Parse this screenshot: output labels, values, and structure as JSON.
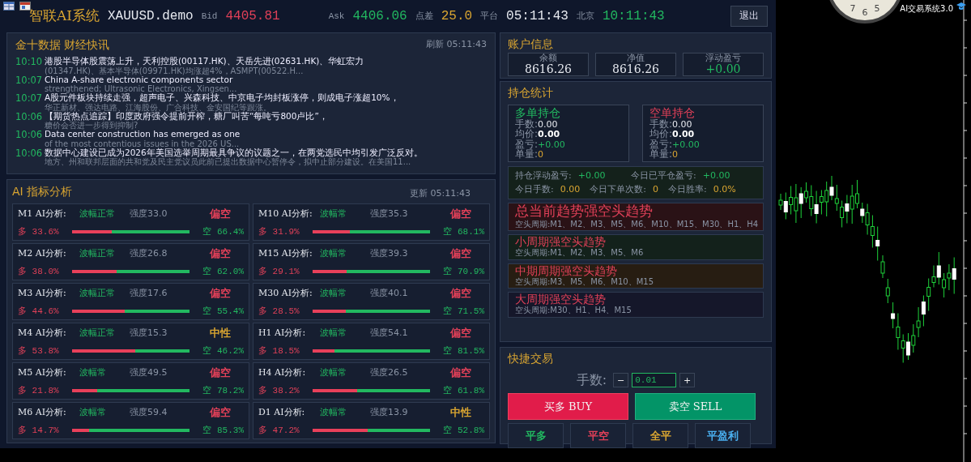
{
  "header": {
    "title": "智联AI系统",
    "symbol": "XAUUSD.demo",
    "bid_label": "Bid",
    "bid": "4405.81",
    "ask_label": "Ask",
    "ask": "4406.06",
    "spread_label": "点差",
    "spread": "25.0",
    "platform_label": "平台",
    "platform_time": "05:11:43",
    "beijing_label": "北京",
    "beijing_time": "10:11:43",
    "exit_button": "退出"
  },
  "news": {
    "title": "金十数据 财经快讯",
    "refresh": "刷新 05:11:43",
    "items": [
      {
        "time": "10:10",
        "headline": "港股半导体股震荡上升，天利控股(00117.HK)、天岳先进(02631.HK)、华虹宏力",
        "detail": "(01347.HK)、基本半导体(09971.HK)均涨超4%，ASMPT(00522.H..."
      },
      {
        "time": "10:07",
        "headline": "China A-share electronic components sector",
        "detail": "strengthened; Ultrasonic Electronics, Xingsen..."
      },
      {
        "time": "10:07",
        "headline": "A股元件板块持续走强，超声电子、兴森科技、中京电子均封板涨停，则成电子涨超10%，",
        "detail": "华正新材、强达电路、江海股份、广合科技、金安国纪等跟涨。"
      },
      {
        "time": "10:06",
        "headline": "【期货热点追踪】印度政府强令提前开榨，糖厂叫苦“每吨亏800卢比”，",
        "detail": "糖价会否进一步得到抑制?"
      },
      {
        "time": "10:06",
        "headline": "Data center construction has emerged as one",
        "detail": "of the most contentious issues in the 2026 US..."
      },
      {
        "time": "10:06",
        "headline": "数据中心建设已成为2026年美国选举周期最具争议的议题之一，在两党选民中均引发广泛反对。",
        "detail": "地方、州和联邦层面的共和党及民主党议员此前已提出数据中心暂停令，拟中止部分建设。在美国11..."
      }
    ]
  },
  "ai": {
    "title": "AI 指标分析",
    "updated": "更新 05:11:43",
    "cards": [
      {
        "label": "M1 AI分析:",
        "volatility": "波幅正常",
        "strength": "强度33.0",
        "bias": "偏空",
        "color": "#e04058",
        "bull": "多 33.6%",
        "bear": "空 66.4%",
        "level": 0.336
      },
      {
        "label": "M10 AI分析:",
        "volatility": "波幅常",
        "strength": "强度35.3",
        "bias": "偏空",
        "color": "#e04058",
        "bull": "多 31.9%",
        "bear": "空 68.1%",
        "level": 0.319
      },
      {
        "label": "M2 AI分析:",
        "volatility": "波幅正常",
        "strength": "强度26.8",
        "bias": "偏空",
        "color": "#e04058",
        "bull": "多 38.0%",
        "bear": "空 62.0%",
        "level": 0.38
      },
      {
        "label": "M15 AI分析:",
        "volatility": "波幅常",
        "strength": "强度39.3",
        "bias": "偏空",
        "color": "#e04058",
        "bull": "多 29.1%",
        "bear": "空 70.9%",
        "level": 0.291
      },
      {
        "label": "M3 AI分析:",
        "volatility": "波幅正常",
        "strength": "强度17.6",
        "bias": "偏空",
        "color": "#e04058",
        "bull": "多 44.6%",
        "bear": "空 55.4%",
        "level": 0.446
      },
      {
        "label": "M30 AI分析:",
        "volatility": "波幅常",
        "strength": "强度40.1",
        "bias": "偏空",
        "color": "#e04058",
        "bull": "多 28.5%",
        "bear": "空 71.5%",
        "level": 0.285
      },
      {
        "label": "M4 AI分析:",
        "volatility": "波幅正常",
        "strength": "强度15.3",
        "bias": "中性",
        "color": "#d9a531",
        "bull": "多 53.8%",
        "bear": "空 46.2%",
        "level": 0.538
      },
      {
        "label": "H1 AI分析:",
        "volatility": "波幅常",
        "strength": "强度54.1",
        "bias": "偏空",
        "color": "#e04058",
        "bull": "多 18.5%",
        "bear": "空 81.5%",
        "level": 0.185
      },
      {
        "label": "M5 AI分析:",
        "volatility": "波幅常",
        "strength": "强度49.5",
        "bias": "偏空",
        "color": "#e04058",
        "bull": "多 21.8%",
        "bear": "空 78.2%",
        "level": 0.218
      },
      {
        "label": "H4 AI分析:",
        "volatility": "波幅常",
        "strength": "强度26.5",
        "bias": "偏空",
        "color": "#e04058",
        "bull": "多 38.2%",
        "bear": "空 61.8%",
        "level": 0.382
      },
      {
        "label": "M6 AI分析:",
        "volatility": "波幅常",
        "strength": "强度59.4",
        "bias": "偏空",
        "color": "#e04058",
        "bull": "多 14.7%",
        "bear": "空 85.3%",
        "level": 0.147
      },
      {
        "label": "D1 AI分析:",
        "volatility": "波幅常",
        "strength": "强度13.9",
        "bias": "中性",
        "color": "#d9a531",
        "bull": "多 47.2%",
        "bear": "空 52.8%",
        "level": 0.472
      }
    ]
  },
  "account": {
    "title": "账户信息",
    "items": [
      {
        "label": "余额",
        "value": "8616.26",
        "color": "#e6e9ef"
      },
      {
        "label": "净值",
        "value": "8616.26",
        "color": "#e6e9ef"
      },
      {
        "label": "浮动盈亏",
        "value": "+0.00",
        "color": "#22b860"
      }
    ]
  },
  "positions": {
    "title": "持仓统计",
    "sides": [
      {
        "title": "多单持仓",
        "color": "#22b860",
        "fields": [
          {
            "label": "手数:",
            "value": "0.00",
            "color": "#e6e9ef"
          },
          {
            "label": "均价:",
            "value": "0.00",
            "color": "#ffffff"
          },
          {
            "label": "盈亏:",
            "value": "+0.00",
            "color": "#22b860"
          },
          {
            "label": "单量:",
            "value": "0",
            "color": "#d9a531"
          }
        ]
      },
      {
        "title": "空单持仓",
        "color": "#e04058",
        "fields": [
          {
            "label": "手数:",
            "value": "0.00",
            "color": "#e6e9ef"
          },
          {
            "label": "均价:",
            "value": "0.00",
            "color": "#ffffff"
          },
          {
            "label": "盈亏:",
            "value": "+0.00",
            "color": "#22b860"
          },
          {
            "label": "单量:",
            "value": "0",
            "color": "#d9a531"
          }
        ]
      }
    ],
    "stats": [
      {
        "label": "持仓浮动盈亏:",
        "value": "+0.00",
        "color": "#22b860"
      },
      {
        "label": "今日已平仓盈亏:",
        "value": "+0.00",
        "color": "#22b860"
      },
      {
        "label": "今日手数:",
        "value": "0.00",
        "color": "#d9a531"
      },
      {
        "label": "今日下单次数:",
        "value": "0",
        "color": "#d9a531"
      },
      {
        "label": "今日胜率:",
        "value": "0.0%",
        "color": "#d9a531"
      }
    ],
    "trends": [
      {
        "title": "总当前趋势强空头趋势",
        "periods": "空头周期:M1、M2、M3、M5、M6、M10、M15、M30、H1、H4",
        "color": "#2a1216"
      },
      {
        "title": "小周期强空头趋势",
        "periods": "空头周期:M1、M2、M3、M5、M6",
        "color": "#13211b"
      },
      {
        "title": "中期周期强空头趋势",
        "periods": "空头周期:M3、M5、M6、M10、M15",
        "color": "#271d12"
      },
      {
        "title": "大周期强空头趋势",
        "periods": "空头周期:M30、H1、H4、M15",
        "color": "#15172a"
      }
    ]
  },
  "quick_trade": {
    "title": "快捷交易",
    "lots_label": "手数:",
    "minus": "−",
    "lots": "0.01",
    "plus": "+",
    "buy": "买多 BUY",
    "sell": "卖空 SELL",
    "close_buttons": [
      {
        "label": "平多",
        "color": "#22b860"
      },
      {
        "label": "平空",
        "color": "#e04058"
      },
      {
        "label": "全平",
        "color": "#d9a531"
      },
      {
        "label": "平盈利",
        "color": "#4ab0f0"
      }
    ]
  },
  "chart": {
    "title": "AI交易系统3.0",
    "clock_numbers": [
      "7",
      "6",
      "5"
    ]
  }
}
